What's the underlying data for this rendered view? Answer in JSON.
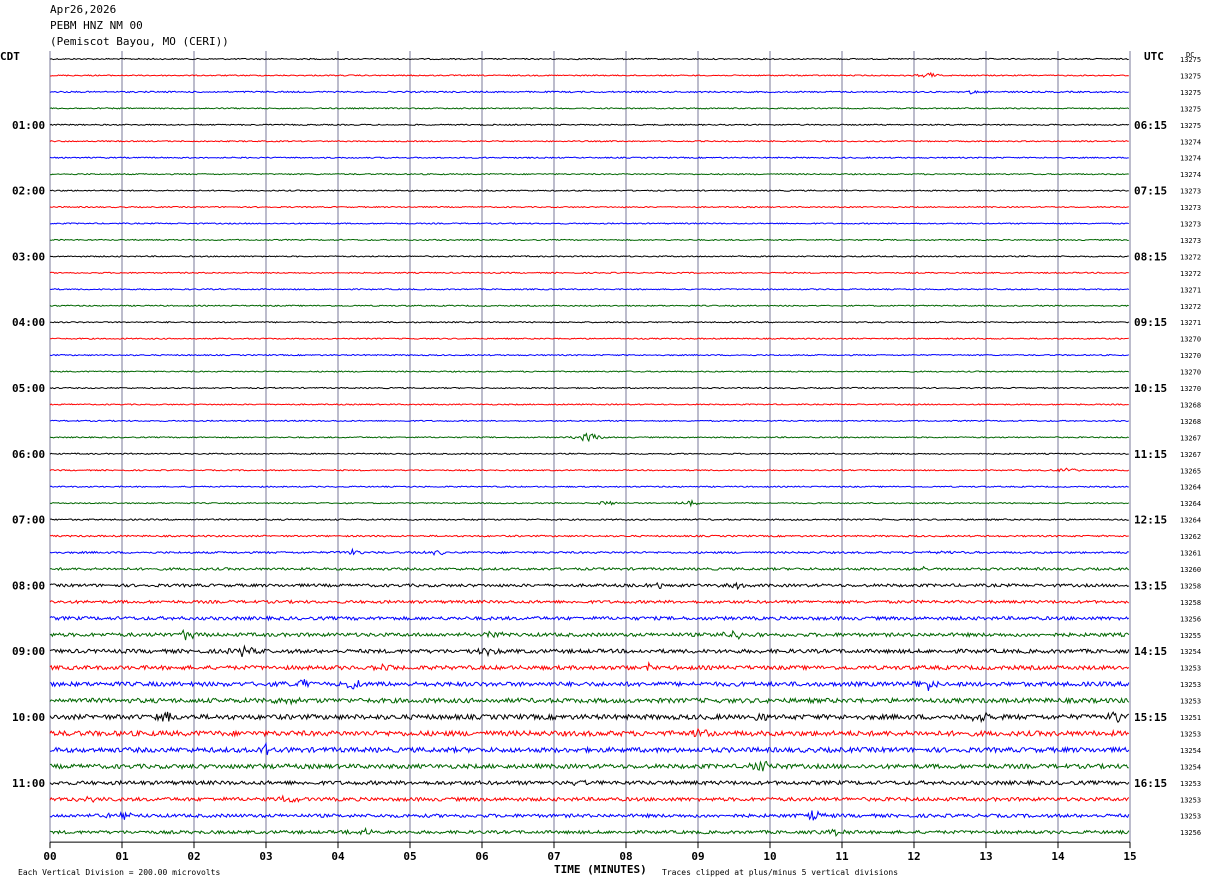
{
  "header": {
    "date": "Apr26,2026",
    "station": "PEBM HNZ NM 00",
    "location": "(Pemiscot Bayou, MO (CERI))"
  },
  "left_zone": "CDT",
  "right_zone": "UTC",
  "dc_label": "DC",
  "footer": {
    "scale": "Each Vertical Division =  200.00 microvolts",
    "xlabel": "TIME (MINUTES)",
    "clip_note": "Traces clipped at plus/minus 5 vertical divisions"
  },
  "colors": {
    "trace_cycle": [
      "#000000",
      "#ff0000",
      "#0000ff",
      "#006600"
    ],
    "grid": "#7a7a9a"
  },
  "chart_data": {
    "type": "line",
    "title": "PEBM HNZ NM 00",
    "xlabel": "TIME (MINUTES)",
    "xlim": [
      0,
      15
    ],
    "x_ticks": [
      "00",
      "01",
      "02",
      "03",
      "04",
      "05",
      "06",
      "07",
      "08",
      "09",
      "10",
      "11",
      "12",
      "13",
      "14",
      "15"
    ],
    "row_count": 48,
    "left_time_labels": [
      {
        "row": 4,
        "text": "01:00"
      },
      {
        "row": 8,
        "text": "02:00"
      },
      {
        "row": 12,
        "text": "03:00"
      },
      {
        "row": 16,
        "text": "04:00"
      },
      {
        "row": 20,
        "text": "05:00"
      },
      {
        "row": 24,
        "text": "06:00"
      },
      {
        "row": 28,
        "text": "07:00"
      },
      {
        "row": 32,
        "text": "08:00"
      },
      {
        "row": 36,
        "text": "09:00"
      },
      {
        "row": 40,
        "text": "10:00"
      },
      {
        "row": 44,
        "text": "11:00"
      }
    ],
    "right_time_labels": [
      {
        "row": 4,
        "text": "06:15"
      },
      {
        "row": 8,
        "text": "07:15"
      },
      {
        "row": 12,
        "text": "08:15"
      },
      {
        "row": 16,
        "text": "09:15"
      },
      {
        "row": 20,
        "text": "10:15"
      },
      {
        "row": 24,
        "text": "11:15"
      },
      {
        "row": 28,
        "text": "12:15"
      },
      {
        "row": 32,
        "text": "13:15"
      },
      {
        "row": 36,
        "text": "14:15"
      },
      {
        "row": 40,
        "text": "15:15"
      },
      {
        "row": 44,
        "text": "16:15"
      }
    ],
    "dc_offsets": [
      "13275",
      "13275",
      "13275",
      "13275",
      "13275",
      "13274",
      "13274",
      "13274",
      "13273",
      "13273",
      "13273",
      "13273",
      "13272",
      "13272",
      "13271",
      "13272",
      "13271",
      "13270",
      "13270",
      "13270",
      "13270",
      "13268",
      "13268",
      "13267",
      "13267",
      "13265",
      "13264",
      "13264",
      "13264",
      "13262",
      "13261",
      "13260",
      "13258",
      "13258",
      "13256",
      "13255",
      "13254",
      "13253",
      "13253",
      "13253",
      "13251",
      "13253",
      "13254",
      "13254",
      "13253",
      "13253",
      "13253",
      "13256"
    ],
    "noise_level": [
      1,
      1,
      1.2,
      1,
      1,
      1,
      1,
      1,
      1,
      1,
      1,
      1,
      1,
      1,
      1,
      1,
      1,
      1,
      1,
      1,
      1,
      1,
      1,
      1,
      1,
      1,
      1,
      1,
      1.2,
      1.3,
      1.6,
      2,
      2.4,
      2.4,
      2.8,
      3,
      3.2,
      3.3,
      3.6,
      3.8,
      4,
      4.2,
      4,
      3.6,
      3.2,
      3,
      2.8,
      2.6
    ],
    "events": [
      {
        "row": 1,
        "minute": 12.2,
        "amp": 5
      },
      {
        "row": 2,
        "minute": 12.8,
        "amp": 3
      },
      {
        "row": 23,
        "minute": 7.5,
        "amp": 9
      },
      {
        "row": 25,
        "minute": 14.1,
        "amp": 4
      },
      {
        "row": 27,
        "minute": 7.7,
        "amp": 4
      },
      {
        "row": 27,
        "minute": 8.9,
        "amp": 5
      },
      {
        "row": 30,
        "minute": 4.2,
        "amp": 4
      },
      {
        "row": 30,
        "minute": 5.4,
        "amp": 4
      },
      {
        "row": 30,
        "minute": 12.4,
        "amp": 3
      },
      {
        "row": 31,
        "minute": 12.1,
        "amp": 3
      },
      {
        "row": 32,
        "minute": 8.5,
        "amp": 6
      },
      {
        "row": 32,
        "minute": 9.6,
        "amp": 8
      },
      {
        "row": 35,
        "minute": 1.9,
        "amp": 7
      },
      {
        "row": 35,
        "minute": 6.1,
        "amp": 7
      },
      {
        "row": 35,
        "minute": 9.5,
        "amp": 8
      },
      {
        "row": 36,
        "minute": 2.7,
        "amp": 8
      },
      {
        "row": 36,
        "minute": 6.1,
        "amp": 6
      },
      {
        "row": 37,
        "minute": 4.6,
        "amp": 6
      },
      {
        "row": 37,
        "minute": 8.3,
        "amp": 6
      },
      {
        "row": 38,
        "minute": 3.5,
        "amp": 7
      },
      {
        "row": 38,
        "minute": 4.2,
        "amp": 7
      },
      {
        "row": 38,
        "minute": 12.2,
        "amp": 8
      },
      {
        "row": 39,
        "minute": 3.3,
        "amp": 5
      },
      {
        "row": 40,
        "minute": 1.6,
        "amp": 8
      },
      {
        "row": 40,
        "minute": 9.9,
        "amp": 11
      },
      {
        "row": 40,
        "minute": 12.9,
        "amp": 9
      },
      {
        "row": 40,
        "minute": 14.8,
        "amp": 9
      },
      {
        "row": 41,
        "minute": 9.0,
        "amp": 6
      },
      {
        "row": 42,
        "minute": 3.0,
        "amp": 7
      },
      {
        "row": 43,
        "minute": 9.9,
        "amp": 8
      },
      {
        "row": 43,
        "minute": 3.0,
        "amp": 6
      },
      {
        "row": 44,
        "minute": 7.3,
        "amp": 5
      },
      {
        "row": 45,
        "minute": 0.5,
        "amp": 6
      },
      {
        "row": 45,
        "minute": 3.3,
        "amp": 7
      },
      {
        "row": 46,
        "minute": 1.0,
        "amp": 8
      },
      {
        "row": 46,
        "minute": 10.6,
        "amp": 7
      },
      {
        "row": 47,
        "minute": 4.4,
        "amp": 6
      },
      {
        "row": 47,
        "minute": 10.9,
        "amp": 5
      }
    ]
  }
}
